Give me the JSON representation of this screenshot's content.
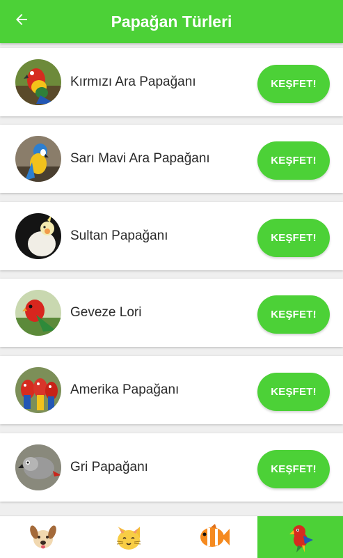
{
  "header": {
    "title": "Papağan Türleri",
    "back_icon": "arrow-left-icon"
  },
  "parrots": [
    {
      "name": "Kırmızı Ara Papağanı",
      "button": "KEŞFET!",
      "image": "scarlet-macaw-photo"
    },
    {
      "name": "Sarı Mavi Ara Papağanı",
      "button": "KEŞFET!",
      "image": "blue-yellow-macaw-photo"
    },
    {
      "name": "Sultan Papağanı",
      "button": "KEŞFET!",
      "image": "cockatiel-photo"
    },
    {
      "name": "Geveze Lori",
      "button": "KEŞFET!",
      "image": "chattering-lory-photo"
    },
    {
      "name": "Amerika Papağanı",
      "button": "KEŞFET!",
      "image": "amazon-parrots-photo"
    },
    {
      "name": "Gri Papağanı",
      "button": "KEŞFET!",
      "image": "grey-parrot-photo"
    }
  ],
  "bottom_nav": [
    {
      "icon": "dog-icon",
      "active": false
    },
    {
      "icon": "cat-icon",
      "active": false
    },
    {
      "icon": "fish-icon",
      "active": false
    },
    {
      "icon": "parrot-icon",
      "active": true
    }
  ],
  "colors": {
    "primary": "#4cd137",
    "background": "#efefef",
    "card": "#ffffff",
    "text": "#2a2a2a"
  }
}
